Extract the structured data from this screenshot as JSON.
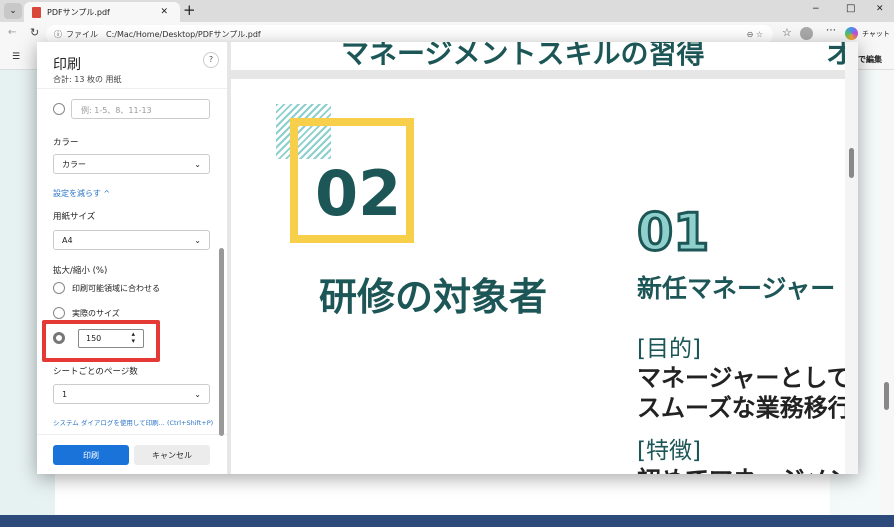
{
  "browser": {
    "tab_title": "PDFサンプル.pdf",
    "new_tab": "+",
    "address_label": "ファイル",
    "url": "C:/Mac/Home/Desktop/PDFサンプル.pdf",
    "chat_label": "チャット",
    "edit_label": "で編集",
    "window_controls": [
      "−",
      "□",
      "✕"
    ]
  },
  "print": {
    "title": "印刷",
    "subtitle": "合計: 13 枚の 用紙",
    "help": "?",
    "pages_placeholder": "例: 1-5、8、11-13",
    "color_label": "カラー",
    "color_value": "カラー",
    "fewer_settings": "設定を減らす ^",
    "paper_label": "用紙サイズ",
    "paper_value": "A4",
    "scale_label": "拡大/縮小 (%)",
    "scale_options": [
      "印刷可能領域に合わせる",
      "実際のサイズ"
    ],
    "scale_value": "150",
    "pages_per_sheet_label": "シートごとのページ数",
    "pages_per_sheet_value": "1",
    "system_dialog_link": "システム ダイアログを使用して印刷... (Ctrl+Shift+P)",
    "print_button": "印刷",
    "cancel_button": "キャンセル",
    "accent_color": "#1a73d9",
    "highlight_color": "#e53935"
  },
  "preview": {
    "header_text": "マネージメントスキルの習得",
    "header_tail": "オ",
    "number_big": "02",
    "target_heading": "研修の対象者",
    "number_outline": "01",
    "role": "新任マネージャー",
    "purpose_label": "[目的]",
    "purpose_line1": "マネージャーとしての",
    "purpose_line2": "スムーズな業務移行を",
    "feature_label": "[特徴]",
    "feature_line1": "初めてマネージメン"
  }
}
